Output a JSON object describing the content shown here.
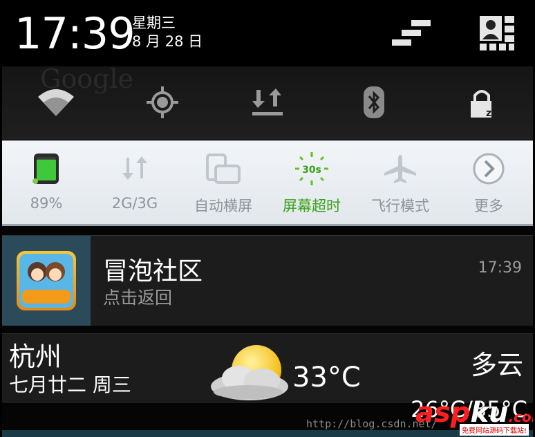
{
  "header": {
    "clock": "17:39",
    "weekday": "星期三",
    "date": "8 月 28 日"
  },
  "quick_toggles": [
    {
      "name": "wifi",
      "icon": "wifi-icon"
    },
    {
      "name": "gps",
      "icon": "location-icon"
    },
    {
      "name": "data",
      "icon": "data-transfer-icon"
    },
    {
      "name": "bluetooth",
      "icon": "bluetooth-icon"
    },
    {
      "name": "lock",
      "icon": "sleep-lock-icon"
    }
  ],
  "toggles": [
    {
      "label": "89%",
      "icon": "battery-icon",
      "level": 0.89
    },
    {
      "label": "2G/3G",
      "icon": "network-switch-icon"
    },
    {
      "label": "自动横屏",
      "icon": "rotate-icon"
    },
    {
      "label": "屏幕超时",
      "icon": "screen-timeout-icon",
      "badge": "30s",
      "active": true
    },
    {
      "label": "飞行模式",
      "icon": "airplane-icon"
    },
    {
      "label": "更多",
      "icon": "chevron-right-icon"
    }
  ],
  "notification": {
    "title": "冒泡社区",
    "subtitle": "点击返回",
    "time": "17:39",
    "icon_text": "冒泡社区"
  },
  "weather": {
    "city": "杭州",
    "date": "七月廿二  周三",
    "temp": "33°C",
    "condition": "多云",
    "range": "26°C/35°C"
  },
  "watermark": {
    "url": "http://blog.csdn.net/",
    "logo_a": "asp",
    "logo_b": "ku",
    "logo_c": ".com",
    "tagline": "免费网站源码下载站!"
  },
  "colors": {
    "active_green": "#3aa21a",
    "toggle_gray": "#8c9499"
  }
}
